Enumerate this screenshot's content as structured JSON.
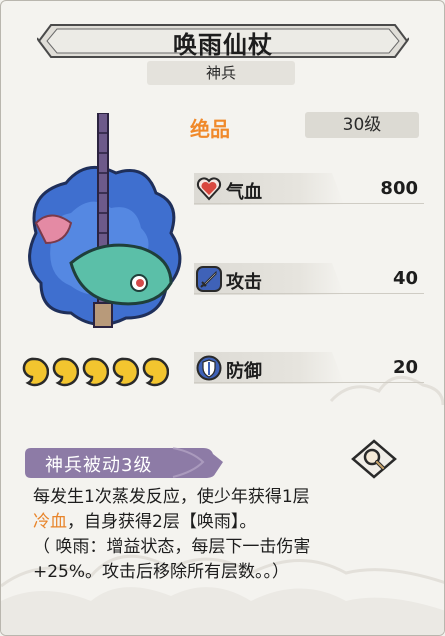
{
  "item": {
    "name": "唤雨仙杖",
    "category": "神兵",
    "grade": "绝品",
    "level": "30级",
    "stars_count": 5
  },
  "stats": [
    {
      "label": "气血",
      "value": "800",
      "icon": "heart-icon"
    },
    {
      "label": "攻击",
      "value": "40",
      "icon": "sword-icon"
    },
    {
      "label": "防御",
      "value": "20",
      "icon": "shield-icon"
    }
  ],
  "passive": {
    "tag": "神兵被动3级",
    "line1": "每发生1次蒸发反应，使少年获得1层",
    "line2_highlight": "冷血",
    "line2_rest": "，自身获得2层【唤雨】。",
    "line3": "（ 唤雨：增益状态，每层下一击伤害",
    "line4": "+25%。攻击后移除所有层数。。）"
  },
  "colors": {
    "accent_orange": "#f0892a",
    "passive_tag": "#8d7ba6",
    "text": "#1d1d1d"
  }
}
